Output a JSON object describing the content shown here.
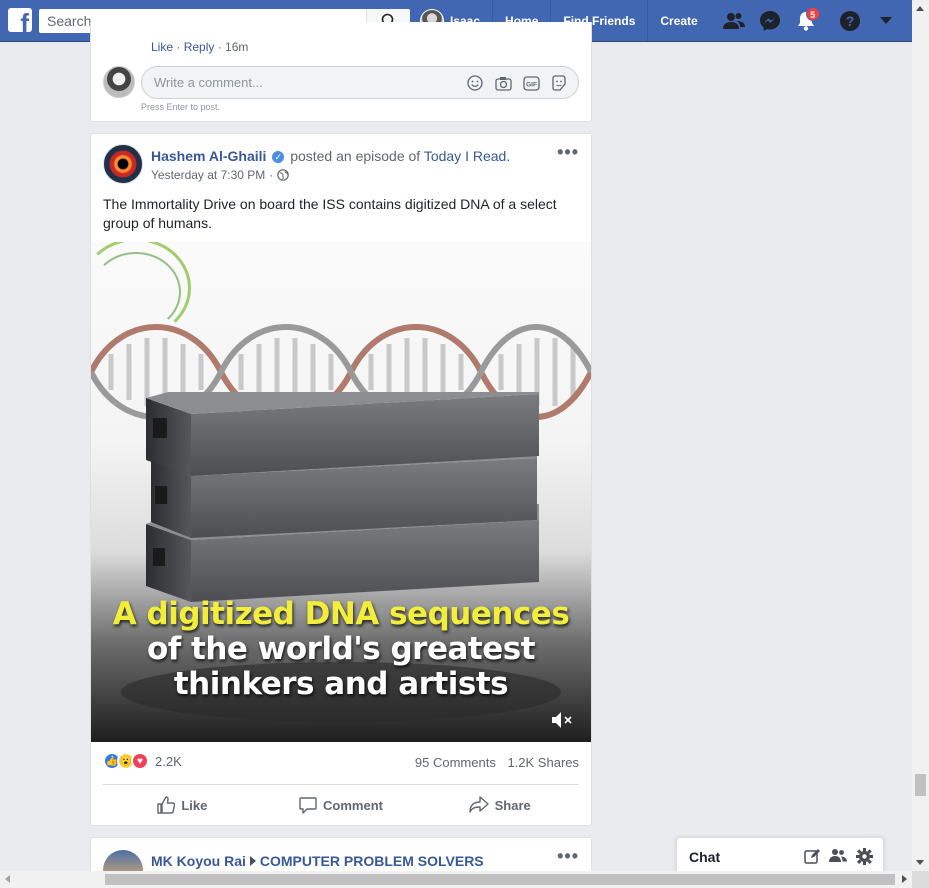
{
  "topbar": {
    "logo": "facebook-f",
    "search_placeholder": "Search",
    "profile_name": "Isaac",
    "nav": [
      "Home",
      "Find Friends",
      "Create"
    ],
    "notifications_count": "5"
  },
  "previous_comment": {
    "like": "Like",
    "reply": "Reply",
    "time": "16m",
    "composer_placeholder": "Write a comment...",
    "press_enter": "Press Enter to post."
  },
  "post": {
    "author": "Hashem Al-Ghaili",
    "action_text": "posted an episode of",
    "page": "Today I Read.",
    "timestamp": "Yesterday at 7:30 PM",
    "text": "The Immortality Drive on board the ISS contains digitized DNA of a select group of humans.",
    "video": {
      "caption_line1": "A digitized DNA sequences",
      "caption_line2": "of the world's greatest",
      "caption_line3": "thinkers and artists"
    },
    "reactions_count": "2.2K",
    "comments": "95 Comments",
    "shares": "1.2K Shares",
    "actions": [
      "Like",
      "Comment",
      "Share"
    ]
  },
  "next_post": {
    "author": "MK Koyou Rai",
    "group": "COMPUTER PROBLEM SOLVERS"
  },
  "chat": {
    "label": "Chat"
  },
  "colors": {
    "brand": "#4267b2",
    "link": "#385898",
    "background": "#e9ebee",
    "notification": "#fa3e3e"
  }
}
